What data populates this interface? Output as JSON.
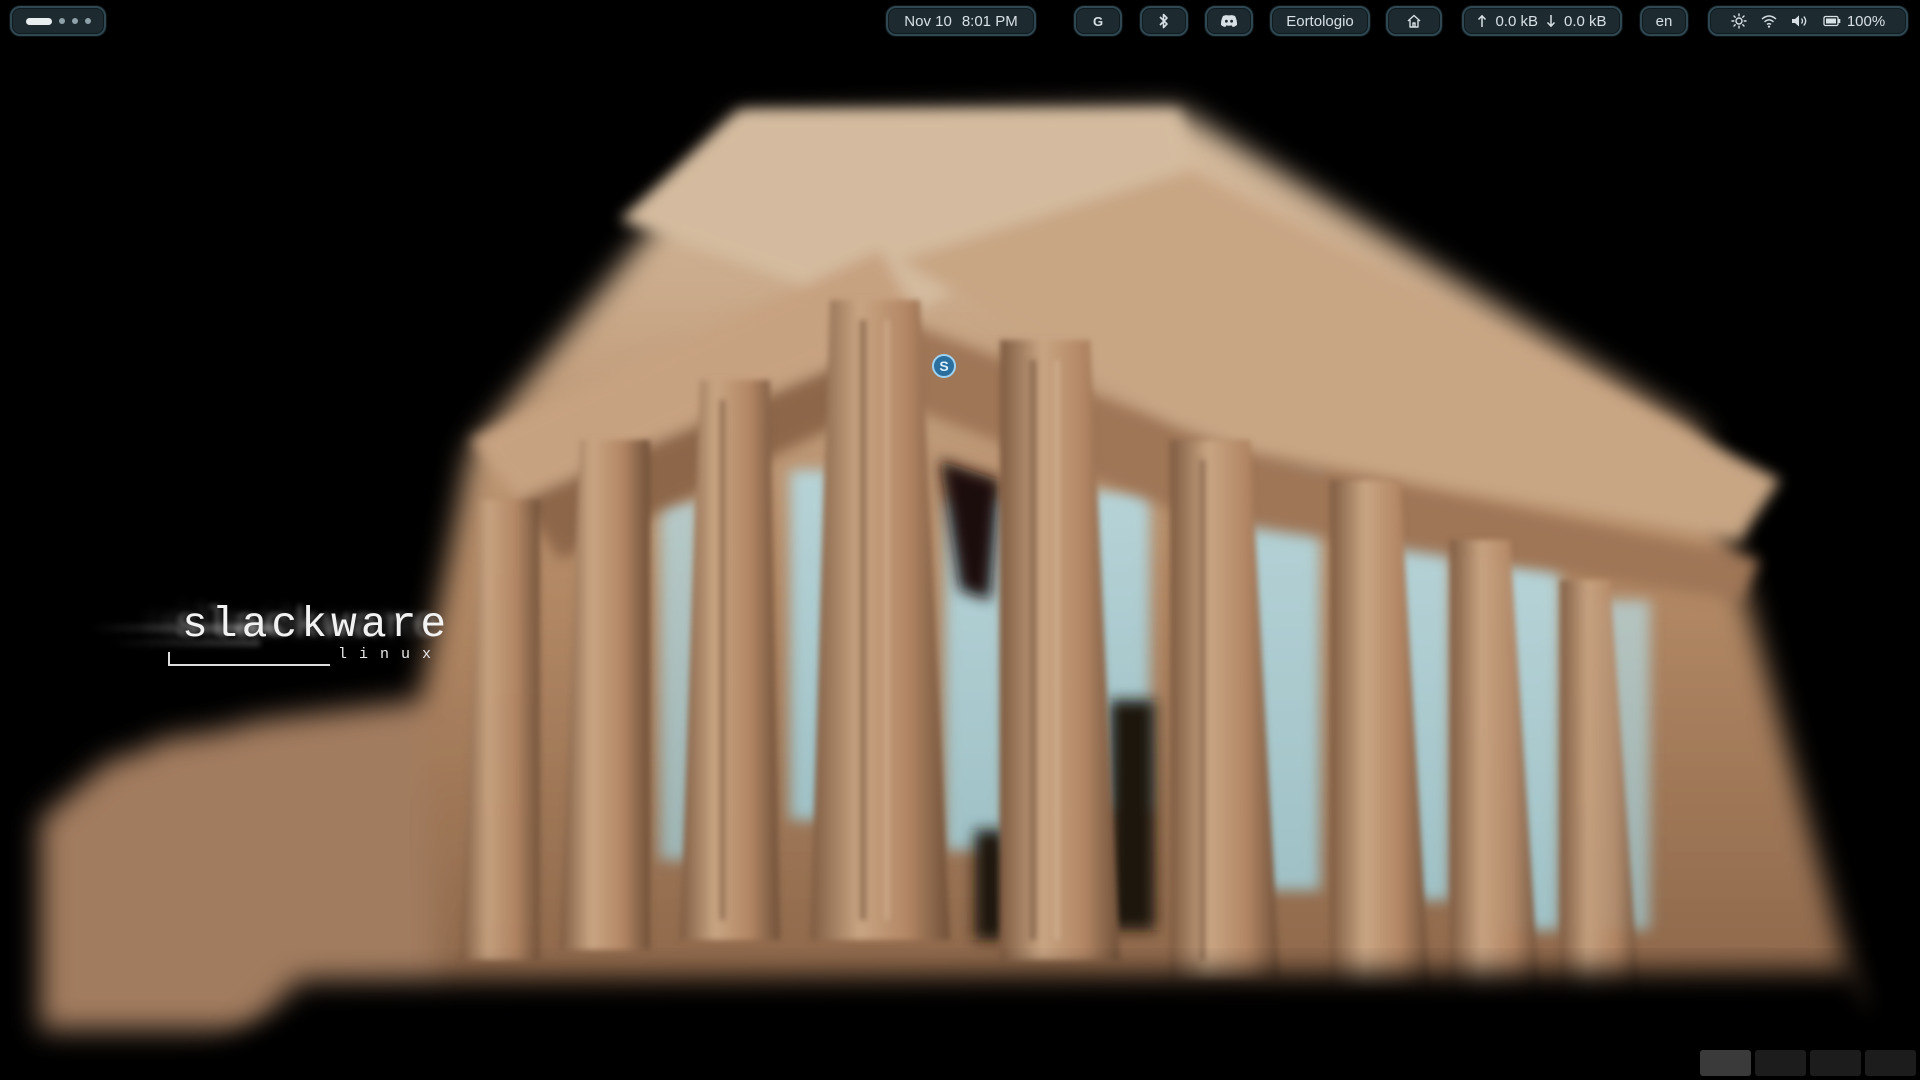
{
  "topbar": {
    "clock": {
      "date": "Nov 10",
      "time": "8:01 PM"
    },
    "g_label": "G",
    "window_title": "Eortologio",
    "network": {
      "upload": "0.0 kB",
      "download": "0.0 kB"
    },
    "language": "en",
    "battery": "100%"
  },
  "desktop": {
    "icon_letter": "S",
    "logo": {
      "word": "slackware",
      "sub": "linux"
    }
  },
  "icons": {
    "bluetooth": "bluetooth-icon",
    "discord": "discord-icon",
    "home": "home-icon",
    "brightness": "brightness-icon",
    "wifi": "wifi-icon",
    "volume": "volume-icon",
    "battery": "battery-icon"
  },
  "colors": {
    "pill_bg": "#1d2a30",
    "pill_border": "#2f4750",
    "pill_text": "#d7e0e4"
  },
  "taskbar": {
    "active_index": 0
  }
}
